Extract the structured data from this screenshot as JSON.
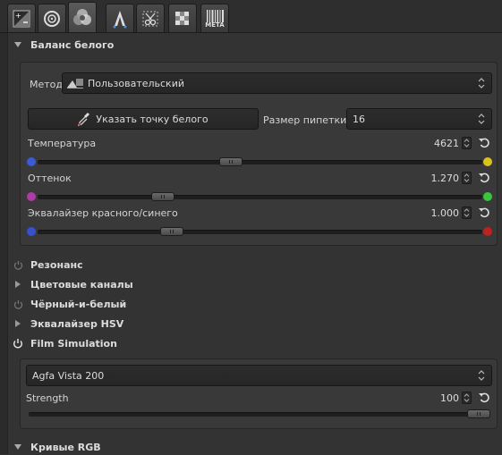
{
  "tabs": [
    {
      "icon": "exposure-icon"
    },
    {
      "icon": "detail-icon"
    },
    {
      "icon": "color-icon",
      "active": true
    },
    {
      "icon": "advanced-icon"
    },
    {
      "icon": "transform-icon"
    },
    {
      "icon": "raw-icon"
    },
    {
      "icon": "metadata-icon",
      "text": "META"
    }
  ],
  "white_balance": {
    "title": "Баланс белого",
    "method_label": "Метод",
    "method_value": "Пользовательский",
    "pick_white_button": "Указать точку белого",
    "pipette_size_label": "Размер пипетки:",
    "pipette_size_value": "16",
    "sliders": [
      {
        "label": "Температура",
        "value": "4621",
        "position": 0.43,
        "left_color": "#3a5bd6",
        "right_color": "#d8c21c"
      },
      {
        "label": "Оттенок",
        "value": "1.270",
        "position": 0.27,
        "left_color": "#b03aa8",
        "right_color": "#3cc43c"
      },
      {
        "label": "Эквалайзер красного/синего",
        "value": "1.000",
        "position": 0.29,
        "left_color": "#3a4fd0",
        "right_color": "#c02020"
      }
    ]
  },
  "sections": [
    {
      "title": "Резонанс",
      "icon": "power-off-icon"
    },
    {
      "title": "Цветовые каналы",
      "icon": "expand-arrow-icon"
    },
    {
      "title": "Чёрный-и-белый",
      "icon": "power-off-icon"
    },
    {
      "title": "Эквалайзер HSV",
      "icon": "expand-arrow-icon"
    }
  ],
  "film_simulation": {
    "title": "Film Simulation",
    "film_value": "Agfa Vista 200",
    "strength_label": "Strength",
    "strength_value": "100",
    "strength_position": 1.0
  },
  "rgb_curves": {
    "title": "Кривые RGB"
  },
  "colors": {
    "background": "#333333",
    "panel": "#393939",
    "field": "#282828"
  }
}
